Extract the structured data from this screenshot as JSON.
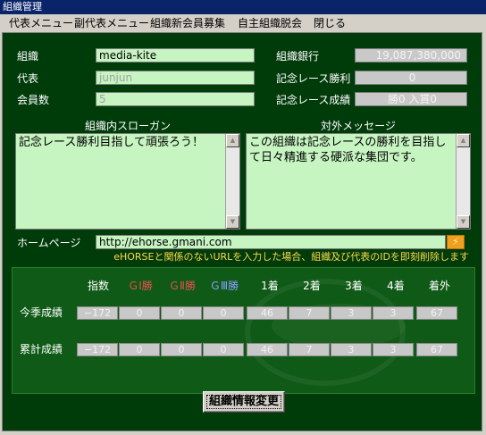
{
  "window": {
    "title": "組織管理"
  },
  "menu": [
    "代表メニュー",
    "副代表メニュー",
    "組織新会員募集",
    "自主組織脱会",
    "閉じる"
  ],
  "form": {
    "org_label": "組織",
    "org_value": "media-kite",
    "rep_label": "代表",
    "rep_value": "junjun",
    "members_label": "会員数",
    "members_value": "5",
    "bank_label": "組織銀行",
    "bank_value": "19,087,380,000",
    "race_win_label": "記念レース勝利",
    "race_win_value": "0",
    "race_result_label": "記念レース成績",
    "race_result_value": "勝0 入賞0"
  },
  "slogan": {
    "label": "組織内スローガン",
    "text": "記念レース勝利目指して頑張ろう！"
  },
  "message": {
    "label": "対外メッセージ",
    "text": "この組織は記念レースの勝利を目指して日々精進する硬派な集団です。"
  },
  "homepage": {
    "label": "ホームページ",
    "value": "http://ehorse.gmani.com",
    "go_icon": "lightning-icon",
    "note": "eHORSEと関係のないURLを入力した場合、組織及び代表のIDを即刻削除します"
  },
  "stats": {
    "headers": [
      {
        "text": "指数",
        "color": "#ffffff"
      },
      {
        "text": "ＧⅠ勝",
        "color": "#e85050"
      },
      {
        "text": "ＧⅡ勝",
        "color": "#e85050"
      },
      {
        "text": "ＧⅢ勝",
        "color": "#8aa0ff"
      },
      {
        "text": "1着",
        "color": "#ffffff"
      },
      {
        "text": "2着",
        "color": "#ffffff"
      },
      {
        "text": "3着",
        "color": "#ffffff"
      },
      {
        "text": "4着",
        "color": "#ffffff"
      },
      {
        "text": "着外",
        "color": "#ffffff"
      }
    ],
    "rows": [
      {
        "label": "今季成績",
        "values": [
          "−172",
          "0",
          "0",
          "0",
          "46",
          "7",
          "3",
          "3",
          "67"
        ]
      },
      {
        "label": "累計成績",
        "values": [
          "−172",
          "0",
          "0",
          "0",
          "46",
          "7",
          "3",
          "3",
          "67"
        ]
      }
    ]
  },
  "actions": {
    "change_button": "組織情報変更"
  }
}
